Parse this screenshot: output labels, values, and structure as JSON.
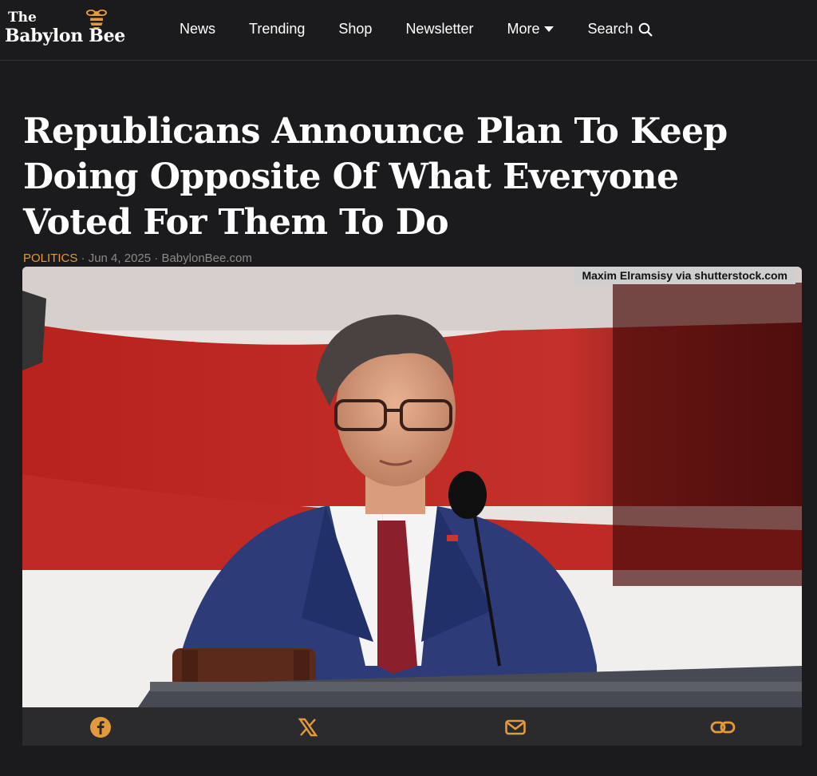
{
  "site": {
    "logo_the": "The",
    "logo_name": "Babylon Bee"
  },
  "nav": {
    "items": [
      "News",
      "Trending",
      "Shop",
      "Newsletter",
      "More",
      "Search"
    ]
  },
  "article": {
    "headline": "Republicans Announce Plan To Keep Doing Opposite Of What Everyone Voted For Them To Do",
    "category": "POLITICS",
    "separator": "·",
    "date": "Jun 4, 2025",
    "source": "BabylonBee.com",
    "photo_credit": "Maxim Elramsisy via shutterstock.com"
  },
  "share": {
    "icons": [
      "facebook-icon",
      "x-icon",
      "email-icon",
      "link-icon"
    ]
  },
  "colors": {
    "accent": "#e29a3b",
    "background": "#1b1b1d"
  }
}
